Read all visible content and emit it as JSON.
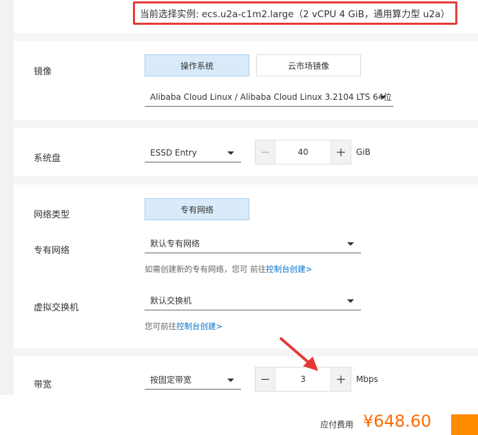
{
  "instance": {
    "text": "当前选择实例: ecs.u2a-c1m2.large（2 vCPU 4 GiB，通用算力型 u2a）"
  },
  "image": {
    "label": "镜像",
    "tabs": [
      {
        "label": "操作系统",
        "active": true
      },
      {
        "label": "云市场镜像",
        "active": false
      }
    ],
    "os_select": "Alibaba Cloud Linux / Alibaba Cloud Linux 3.2104 LTS 64位"
  },
  "disk": {
    "label": "系统盘",
    "type_select": "ESSD Entry",
    "size_value": "40",
    "unit": "GiB"
  },
  "network": {
    "type_label": "网络类型",
    "type_tab": "专有网络",
    "vpc_label": "专有网络",
    "vpc_select": "默认专有网络",
    "vpc_hint_prefix": "如需创建新的专有网络，您可 前往",
    "vpc_hint_link": "控制台创建>",
    "vswitch_label": "虚拟交换机",
    "vswitch_select": "默认交换机",
    "vswitch_hint_prefix": "您可前往",
    "vswitch_hint_link": "控制台创建>"
  },
  "bandwidth": {
    "label": "带宽",
    "mode_select": "按固定带宽",
    "value": "3",
    "unit": "Mbps"
  },
  "footer": {
    "price_label": "应付费用",
    "price": "¥648.60"
  },
  "icons": {
    "minus": "−",
    "plus": "+"
  },
  "colors": {
    "accent_blue": "#0070cc",
    "active_tab_bg": "#d9ebfa",
    "price_orange": "#ff6a00",
    "highlight_red": "#e53935"
  }
}
